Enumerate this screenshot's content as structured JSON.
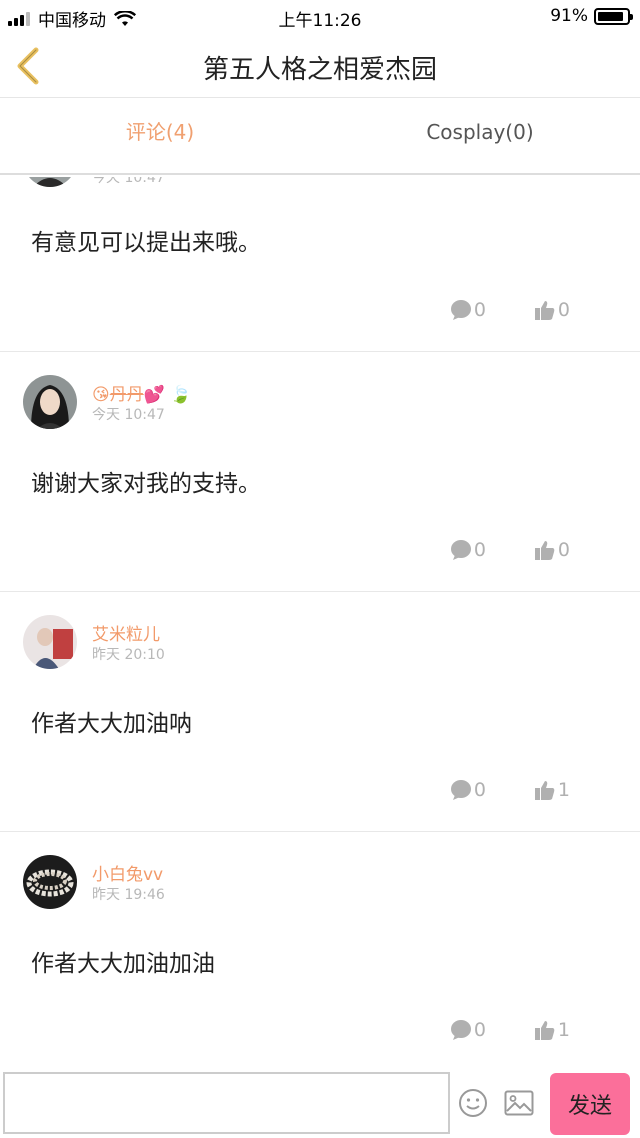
{
  "status_bar": {
    "carrier": "中国移动",
    "time": "上午11:26",
    "battery": "91%",
    "battery_level": 0.91
  },
  "nav": {
    "title": "第五人格之相爱杰园"
  },
  "tabs": [
    {
      "label": "评论(4)",
      "active": true
    },
    {
      "label": "Cosplay(0)",
      "active": false
    }
  ],
  "partial_comment": {
    "time": "今天 10:47",
    "text": "有意见可以提出来哦。",
    "comment_count": "0",
    "like_count": "0"
  },
  "comments": [
    {
      "username": "丹丹",
      "time": "今天 10:47",
      "text": "谢谢大家对我的支持。",
      "comment_count": "0",
      "like_count": "0"
    },
    {
      "username": "艾米粒儿",
      "time": "昨天 20:10",
      "text": "作者大大加油呐",
      "comment_count": "0",
      "like_count": "1"
    },
    {
      "username": "小白兔vv",
      "time": "昨天 19:46",
      "text": "作者大大加油加油",
      "comment_count": "0",
      "like_count": "1"
    }
  ],
  "input_bar": {
    "placeholder": "",
    "send_label": "发送"
  },
  "colors": {
    "accent": "#f0a070",
    "send_button": "#fb6f9a",
    "back_arrow": "#e8c060"
  }
}
